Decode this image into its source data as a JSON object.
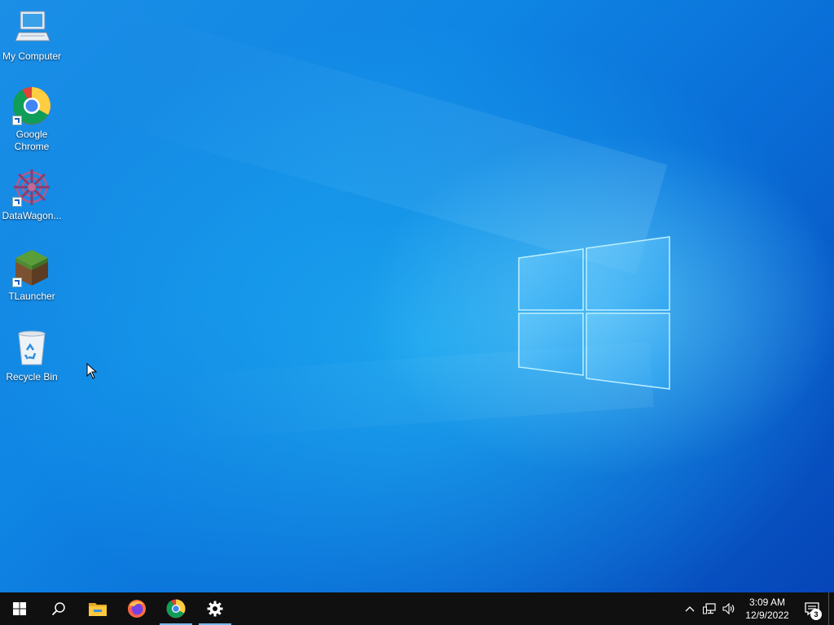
{
  "desktop": {
    "icons": [
      {
        "label": "My Computer",
        "icon": "computer-icon"
      },
      {
        "label": "Google Chrome",
        "icon": "chrome-icon"
      },
      {
        "label": "DataWagon...",
        "icon": "datawagon-icon"
      },
      {
        "label": "TLauncher",
        "icon": "minecraft-grass-block-icon"
      },
      {
        "label": "Recycle Bin",
        "icon": "recycle-bin-icon"
      }
    ],
    "wallpaper": "windows-10-default-logo"
  },
  "taskbar": {
    "pinned": [
      {
        "name": "start",
        "icon": "windows-start-icon",
        "running": false
      },
      {
        "name": "search",
        "icon": "search-icon",
        "running": false
      },
      {
        "name": "file-explorer",
        "icon": "folder-icon",
        "running": false
      },
      {
        "name": "firefox",
        "icon": "firefox-icon",
        "running": false
      },
      {
        "name": "chrome",
        "icon": "chrome-icon",
        "running": true
      },
      {
        "name": "settings",
        "icon": "gear-icon",
        "running": true
      }
    ],
    "tray": {
      "icons": [
        "chevron-up-icon",
        "network-icon",
        "volume-icon"
      ],
      "time": "3:09 AM",
      "date": "12/9/2022",
      "notification_count": "3"
    }
  },
  "colors": {
    "taskbar_bg": "#101010",
    "wallpaper_blue": "#0a6fd8",
    "running_indicator": "#76b9ed"
  }
}
